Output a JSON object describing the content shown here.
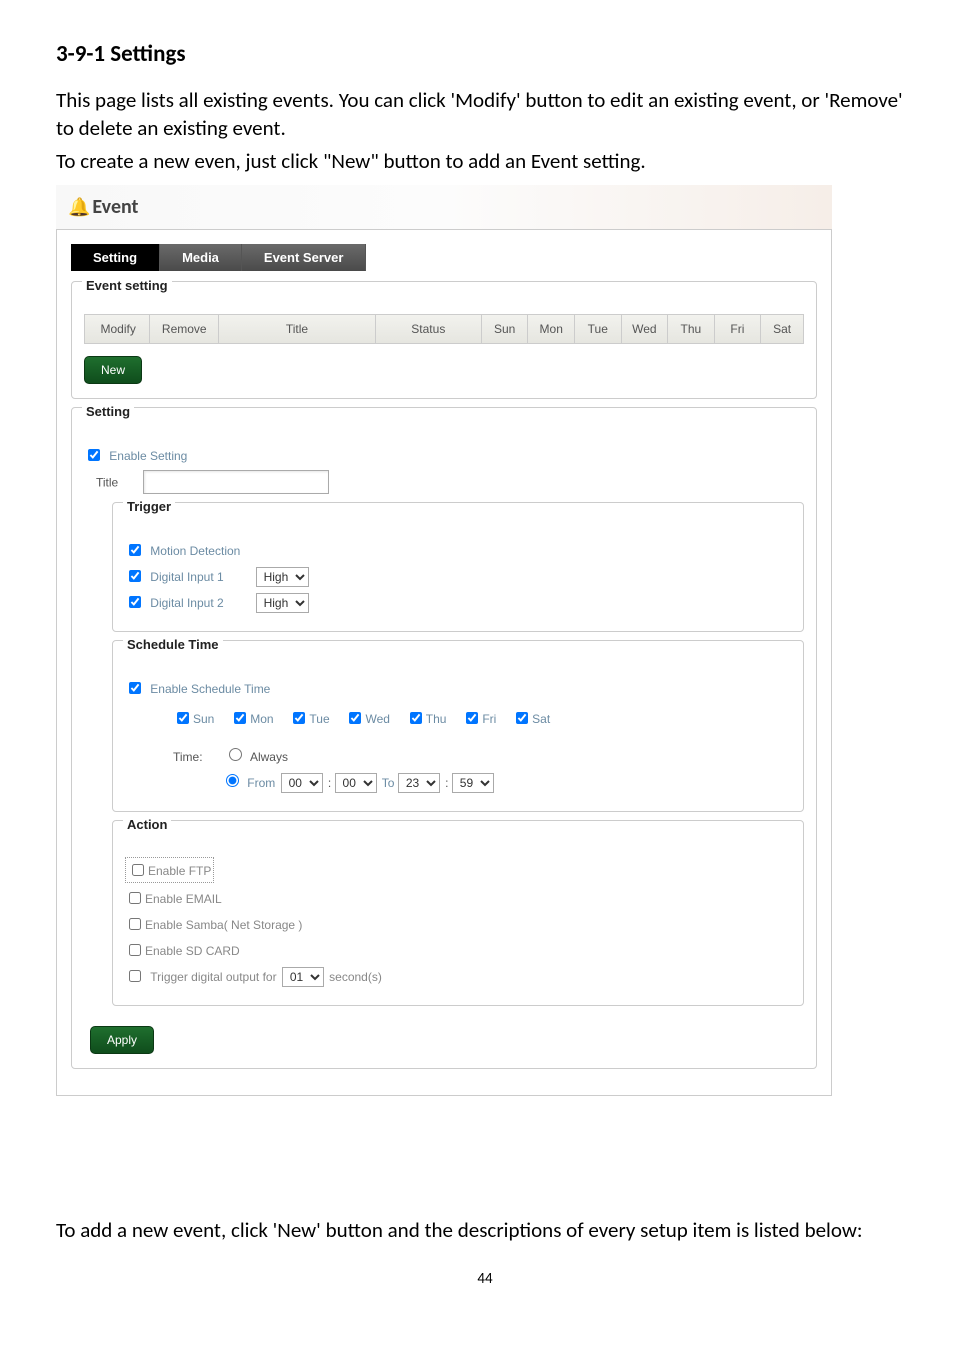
{
  "heading": "3-9-1 Settings",
  "para1": "This page lists all existing events. You can click 'Modify' button to edit an existing event, or 'Remove' to delete an existing event.",
  "para2": "To create a new even, just click \"New\" button to add an Event setting.",
  "event": {
    "title": "Event",
    "tabs": {
      "setting": "Setting",
      "media": "Media",
      "server": "Event Server"
    },
    "settingBox": {
      "legend": "Event setting",
      "cols": {
        "modify": "Modify",
        "remove": "Remove",
        "title": "Title",
        "status": "Status",
        "sun": "Sun",
        "mon": "Mon",
        "tue": "Tue",
        "wed": "Wed",
        "thu": "Thu",
        "fri": "Fri",
        "sat": "Sat"
      },
      "newBtn": "New"
    },
    "form": {
      "legend": "Setting",
      "enable": "Enable Setting",
      "titleLabel": "Title",
      "trigger": {
        "legend": "Trigger",
        "motion": "Motion Detection",
        "di1": "Digital Input 1",
        "di2": "Digital Input 2",
        "high": "High"
      },
      "schedule": {
        "legend": "Schedule Time",
        "enable": "Enable Schedule Time",
        "days": {
          "sun": "Sun",
          "mon": "Mon",
          "tue": "Tue",
          "wed": "Wed",
          "thu": "Thu",
          "fri": "Fri",
          "sat": "Sat"
        },
        "timeLabel": "Time:",
        "always": "Always",
        "from": "From",
        "to": "To",
        "h1": "00",
        "m1": "00",
        "h2": "23",
        "m2": "59"
      },
      "action": {
        "legend": "Action",
        "ftp": "Enable FTP",
        "email": "Enable EMAIL",
        "samba": "Enable Samba( Net Storage )",
        "sd": "Enable SD CARD",
        "trigText1": "Trigger digital output for",
        "trigSec": "01",
        "trigText2": "second(s)"
      },
      "applyBtn": "Apply"
    }
  },
  "para3": "To add a new event, click 'New' button and the descriptions of every setup item is listed below:",
  "pageNum": "44"
}
